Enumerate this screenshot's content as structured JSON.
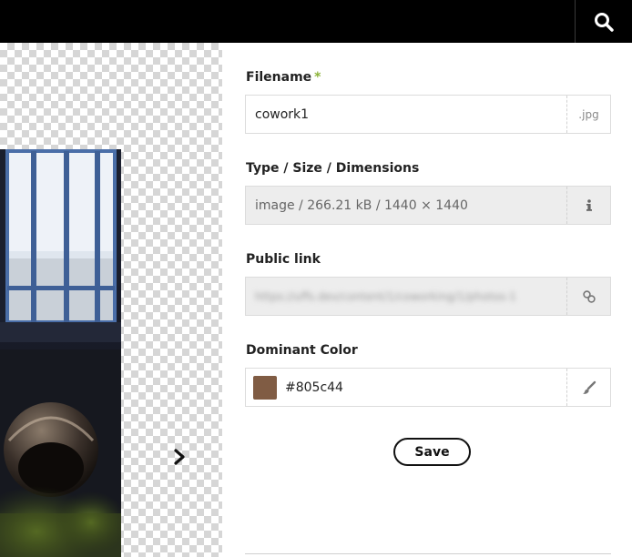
{
  "header": {
    "search_icon": "search-icon"
  },
  "preview": {
    "next_icon": "chevron-right-icon"
  },
  "form": {
    "filename": {
      "label": "Filename",
      "required_mark": "*",
      "value": "cowork1",
      "extension": ".jpg"
    },
    "type_size": {
      "label": "Type / Size / Dimensions",
      "value": "image / 266.21 kB / 1440 × 1440",
      "icon": "info-icon"
    },
    "public_link": {
      "label": "Public link",
      "value": "https://uffs.dev/content/1/coworking/1/photos-1",
      "icon": "link-icon"
    },
    "dominant_color": {
      "label": "Dominant Color",
      "value": "#805c44",
      "swatch_color": "#805c44",
      "icon": "paintbrush-icon"
    },
    "save_label": "Save"
  },
  "colors": {
    "accent_required": "#8cb338",
    "topbar": "#000000"
  }
}
